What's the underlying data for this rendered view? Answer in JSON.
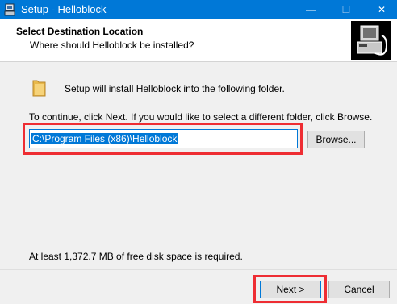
{
  "window": {
    "title": "Setup - Helloblock",
    "minimize_glyph": "—",
    "maximize_glyph": "☐",
    "close_glyph": "✕"
  },
  "header": {
    "title": "Select Destination Location",
    "subtitle": "Where should Helloblock be installed?"
  },
  "content": {
    "install_message": "Setup will install Helloblock into the following folder.",
    "instructions": "To continue, click Next. If you would like to select a different folder, click Browse.",
    "install_path": "C:\\Program Files (x86)\\Helloblock",
    "browse_label": "Browse...",
    "disk_space": "At least 1,372.7 MB of free disk space is required."
  },
  "footer": {
    "next_label": "Next >",
    "cancel_label": "Cancel"
  },
  "colors": {
    "titlebar": "#0078d7",
    "highlight_frame": "#ee2d33",
    "selection": "#0078d7"
  },
  "icons": [
    "app-icon",
    "installer-logo-icon",
    "folder-icon"
  ]
}
